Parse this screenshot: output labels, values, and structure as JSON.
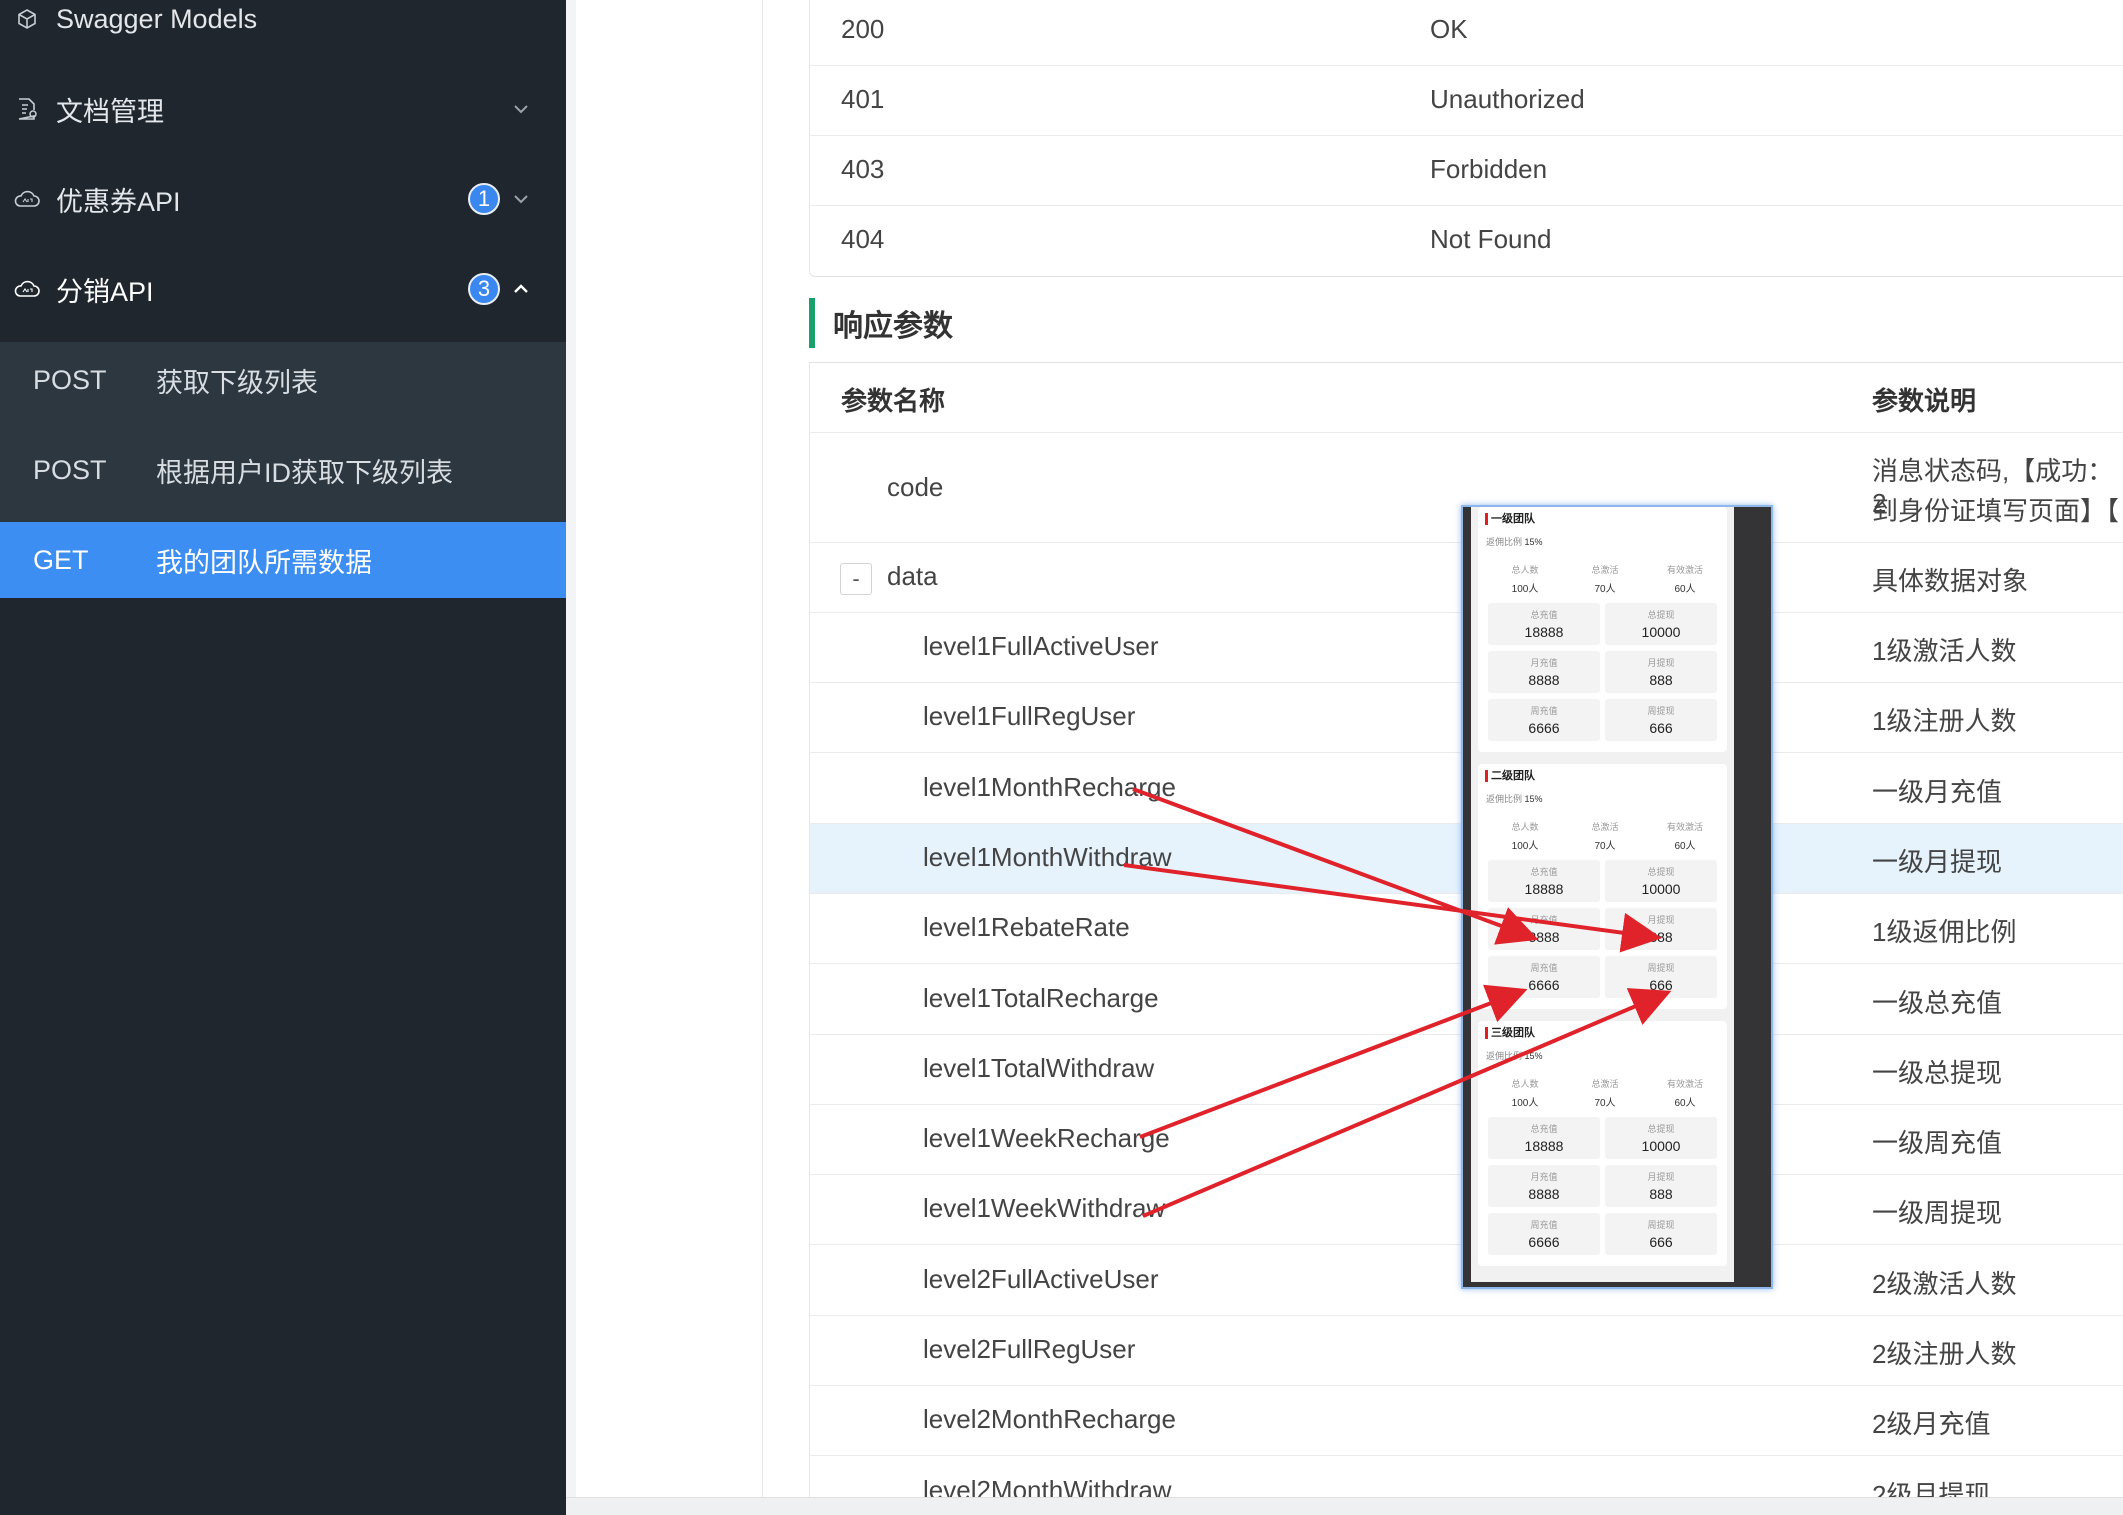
{
  "sidebar": {
    "items": [
      {
        "label": "Swagger Models",
        "icon": "cube-icon"
      },
      {
        "label": "文档管理",
        "icon": "document-settings-icon"
      },
      {
        "label": "优惠券API",
        "icon": "cloud-api-icon",
        "badge": "1"
      },
      {
        "label": "分销API",
        "icon": "cloud-api-icon",
        "badge": "3"
      }
    ],
    "sub_items": [
      {
        "method": "POST",
        "label": "获取下级列表"
      },
      {
        "method": "POST",
        "label": "根据用户ID获取下级列表"
      },
      {
        "method": "GET",
        "label": "我的团队所需数据"
      }
    ]
  },
  "status_table": {
    "rows": [
      {
        "code": "200",
        "desc": "OK"
      },
      {
        "code": "401",
        "desc": "Unauthorized"
      },
      {
        "code": "403",
        "desc": "Forbidden"
      },
      {
        "code": "404",
        "desc": "Not Found"
      }
    ]
  },
  "response": {
    "title": "响应参数",
    "headers": {
      "name": "参数名称",
      "desc": "参数说明"
    },
    "code_row": {
      "name": "code",
      "desc_line1": "消息状态码,【成功：2",
      "desc_line2": "到身份证填写页面】【"
    },
    "data_row": {
      "toggle": "-",
      "name": "data",
      "desc": "具体数据对象"
    },
    "fields": [
      {
        "name": "level1FullActiveUser",
        "desc": "1级激活人数"
      },
      {
        "name": "level1FullRegUser",
        "desc": "1级注册人数"
      },
      {
        "name": "level1MonthRecharge",
        "desc": "一级月充值"
      },
      {
        "name": "level1MonthWithdraw",
        "desc": "一级月提现"
      },
      {
        "name": "level1RebateRate",
        "desc": "1级返佣比例"
      },
      {
        "name": "level1TotalRecharge",
        "desc": "一级总充值"
      },
      {
        "name": "level1TotalWithdraw",
        "desc": "一级总提现"
      },
      {
        "name": "level1WeekRecharge",
        "desc": "一级周充值"
      },
      {
        "name": "level1WeekWithdraw",
        "desc": "一级周提现"
      },
      {
        "name": "level2FullActiveUser",
        "desc": "2级激活人数"
      },
      {
        "name": "level2FullRegUser",
        "desc": "2级注册人数"
      },
      {
        "name": "level2MonthRecharge",
        "desc": "2级月充值"
      },
      {
        "name": "level2MonthWithdraw",
        "desc": "2级月提现"
      }
    ]
  },
  "overlay": {
    "teams": [
      {
        "title": "一级团队",
        "rate_label": "返佣比例",
        "rate": "15%"
      },
      {
        "title": "二级团队",
        "rate_label": "返佣比例",
        "rate": "15%"
      },
      {
        "title": "三级团队",
        "rate_label": "返佣比例",
        "rate": "15%"
      }
    ],
    "stats": [
      {
        "label": "总人数",
        "value": "100人"
      },
      {
        "label": "总激活",
        "value": "70人"
      },
      {
        "label": "有效激活",
        "value": "60人"
      }
    ],
    "cells": [
      {
        "label": "总充值",
        "value": "18888"
      },
      {
        "label": "总提现",
        "value": "10000"
      },
      {
        "label": "月充值",
        "value": "8888"
      },
      {
        "label": "月提现",
        "value": "888"
      },
      {
        "label": "周充值",
        "value": "6666"
      },
      {
        "label": "周提现",
        "value": "666"
      }
    ]
  },
  "colors": {
    "sidebar_bg": "#1f262d",
    "sidebar_sub_bg": "#2d3740",
    "selected_bg": "#3d8ef3",
    "badge": "#3b87f0",
    "section_accent": "#1aa06d",
    "row_highlight": "#e6f3fd",
    "arrow": "#e0222a"
  }
}
